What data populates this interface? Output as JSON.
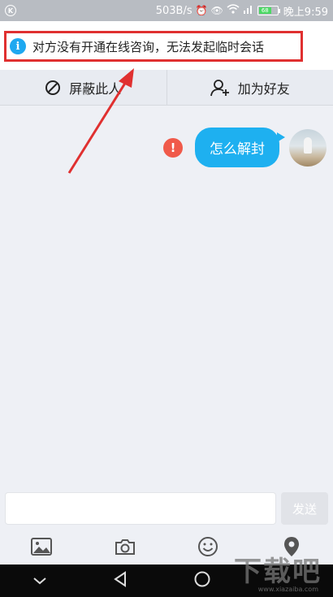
{
  "status_bar": {
    "left_icon": "k-icon",
    "speed": "503B/s",
    "icons": [
      "alarm-icon",
      "eye-icon",
      "wifi-icon",
      "signal-icon"
    ],
    "battery_level": "68",
    "time": "晚上9:59"
  },
  "notice": {
    "icon": "info-icon",
    "text": "对方没有开通在线咨询，无法发起临时会话"
  },
  "actions": {
    "block_label": "屏蔽此人",
    "add_friend_label": "加为好友"
  },
  "chat": {
    "messages": [
      {
        "text": "怎么解封",
        "status": "failed",
        "from": "self"
      }
    ]
  },
  "input": {
    "placeholder": "",
    "send_label": "发送"
  },
  "toolbar": {
    "items": [
      "image-icon",
      "camera-icon",
      "emoji-icon",
      "location-icon"
    ]
  },
  "watermark": {
    "main": "下载吧",
    "sub": "www.xiazaiba.com"
  },
  "colors": {
    "accent": "#1eb0f0",
    "highlight_border": "#e03030",
    "error": "#f05a4a",
    "status_bar": "#b8bcc2"
  }
}
